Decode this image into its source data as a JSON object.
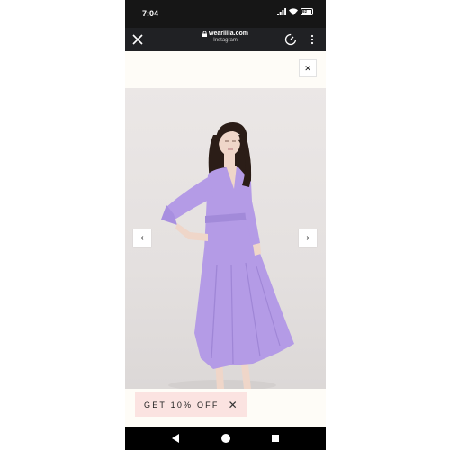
{
  "status_bar": {
    "time": "7:04",
    "battery": "92"
  },
  "url_bar": {
    "domain": "wearlilla.com",
    "subtitle": "Instagram"
  },
  "modal": {
    "close_label": "✕"
  },
  "carousel": {
    "prev_label": "‹",
    "next_label": "›"
  },
  "promo": {
    "text": "GET 10% OFF",
    "dismiss_label": "✕"
  },
  "colors": {
    "dress": "#b49be6",
    "promo_bg": "#fbe3e1",
    "page_bg": "#fefcf7",
    "status_bg": "#161616",
    "urlbar_bg": "#202124"
  },
  "icons": [
    "signal-icon",
    "wifi-icon",
    "battery-icon",
    "close-icon",
    "lock-icon",
    "speed-icon",
    "more-vert-icon",
    "nav-back-icon",
    "nav-home-icon",
    "nav-recent-icon"
  ]
}
